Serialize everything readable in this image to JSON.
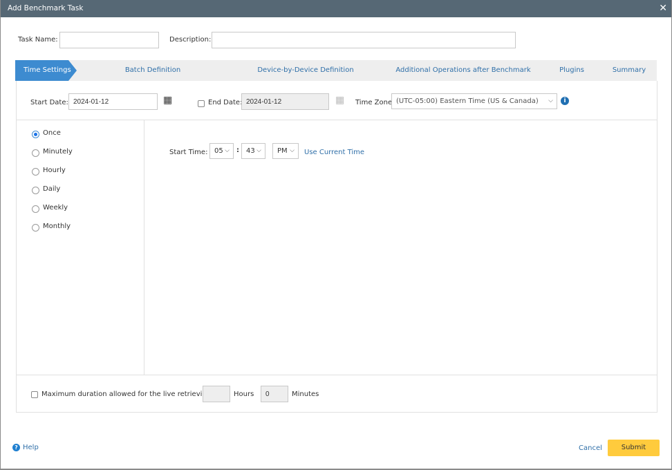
{
  "dialog": {
    "title": "Add Benchmark Task"
  },
  "form": {
    "task_name_label": "Task Name:",
    "task_name_value": "",
    "description_label": "Description:",
    "description_value": ""
  },
  "tabs": [
    {
      "label": "Time Settings",
      "active": true
    },
    {
      "label": "Batch Definition"
    },
    {
      "label": "Device-by-Device Definition"
    },
    {
      "label": "Additional Operations after Benchmark"
    },
    {
      "label": "Plugins"
    },
    {
      "label": "Summary"
    }
  ],
  "dates": {
    "start_label": "Start Date:",
    "start_value": "2024-01-12",
    "end_label": "End Date:",
    "end_value": "2024-01-12",
    "end_checked": false,
    "tz_label": "Time Zone:",
    "tz_value": "(UTC-05:00) Eastern Time (US & Canada)"
  },
  "frequency": {
    "selected": "Once",
    "options": [
      "Once",
      "Minutely",
      "Hourly",
      "Daily",
      "Weekly",
      "Monthly"
    ]
  },
  "start_time": {
    "label": "Start Time:",
    "hour": "05",
    "separator": ":",
    "minute": "43",
    "ampm": "PM",
    "use_current": "Use Current Time"
  },
  "duration": {
    "checked": false,
    "label": "Maximum duration allowed for the live retrieving:",
    "hours_value": "",
    "hours_label": "Hours",
    "minutes_value": "0",
    "minutes_label": "Minutes"
  },
  "footer": {
    "help": "Help",
    "cancel": "Cancel",
    "submit": "Submit"
  },
  "colors": {
    "titlebar": "#566875",
    "active_tab": "#3d8bd0",
    "submit": "#ffcb3d",
    "link": "#2f6fa8"
  }
}
